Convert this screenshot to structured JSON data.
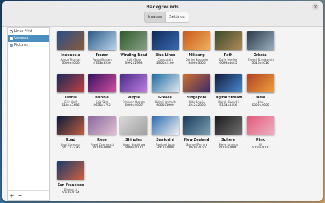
{
  "window": {
    "title": "Backgrounds",
    "close_icon": "×"
  },
  "tabs": [
    {
      "label": "Images",
      "active": true
    },
    {
      "label": "Settings",
      "active": false
    }
  ],
  "sidebar": {
    "items": [
      {
        "label": "Linux Mint",
        "icon": "disc-icon",
        "selected": false
      },
      {
        "label": "Vanessa",
        "icon": "folder-icon",
        "selected": true
      },
      {
        "label": "Pictures",
        "icon": "folder-icon",
        "selected": false
      }
    ],
    "add_label": "+",
    "remove_label": "−"
  },
  "wallpapers": [
    {
      "name": "Indonesia",
      "author": "Aaron Thomas",
      "size": "6000x4000",
      "color": "#2a4f88",
      "color2": "#8b5a3a"
    },
    {
      "name": "Frozen",
      "author": "Aaron Burden",
      "size": "4733x3550",
      "color": "#2e5c8a",
      "color2": "#b9d3ea"
    },
    {
      "name": "Winding Road",
      "author": "Calin Stan",
      "size": "3992x2992",
      "color": "#2f5a2a",
      "color2": "#8aa28a"
    },
    {
      "name": "Blue Lines",
      "author": "Constantin",
      "size": "2800x2100",
      "color": "#0f2a5a",
      "color2": "#3a6ab0"
    },
    {
      "name": "Miksang",
      "author": "Denise Bossarte",
      "size": "5400x3600",
      "color": "#c85a1a",
      "color2": "#f0b060"
    },
    {
      "name": "Path",
      "author": "Dave Hoefler",
      "size": "6698x4445",
      "color": "#3a4a2a",
      "color2": "#b08a5a"
    },
    {
      "name": "Orketal",
      "author": "Evgeni Tcherkasski",
      "size": "6016x4016",
      "color": "#2a3a4a",
      "color2": "#9ab0c0"
    },
    {
      "name": "Tennis",
      "author": "Erik Wolf",
      "size": "5184x3456",
      "color": "#1a2a5a",
      "color2": "#c04040"
    },
    {
      "name": "Bubble",
      "author": "Erik Skof",
      "size": "4635x1752",
      "color": "#3a1060",
      "color2": "#d050a0"
    },
    {
      "name": "Purple",
      "author": "Fabonan Design",
      "size": "6000x4000",
      "color": "#4a2a8a",
      "color2": "#c080e0"
    },
    {
      "name": "Greece",
      "author": "Hello Lightbulb",
      "size": "6000x4000",
      "color": "#1a6aa0",
      "color2": "#e0e8f0"
    },
    {
      "name": "Singapore",
      "author": "Mike Enerio",
      "size": "4242x2828",
      "color": "#d07030",
      "color2": "#3a2a6a"
    },
    {
      "name": "Digital Stream",
      "author": "Marek Piwnicki",
      "size": "5184x3456",
      "color": "#101a3a",
      "color2": "#4a8ad0"
    },
    {
      "name": "India",
      "author": "Navi",
      "size": "6000x4000",
      "color": "#b04020",
      "color2": "#f0a040"
    },
    {
      "name": "Road",
      "author": "Paul Carmona",
      "size": "5472x3236",
      "color": "#0a1a3a",
      "color2": "#c06040"
    },
    {
      "name": "Rose",
      "author": "Pawel Czerwinski",
      "size": "6000x4000",
      "color": "#8a6aa0",
      "color2": "#e0c0d0"
    },
    {
      "name": "Shingles",
      "author": "Roger Bradshaw",
      "size": "6000x4000",
      "color": "#d8d8d8",
      "color2": "#a0a0a0"
    },
    {
      "name": "Santorini",
      "author": "Raphael Louis",
      "size": "2667x4000",
      "color": "#2a6ab0",
      "color2": "#f0f0f0"
    },
    {
      "name": "New Zealand",
      "author": "Samuel Ferrara",
      "size": "3840x2160",
      "color": "#1a3a5a",
      "color2": "#7aa0b0"
    },
    {
      "name": "Sphere",
      "author": "Steve Johnson",
      "size": "6000x4000",
      "color": "#1a1a1a",
      "color2": "#707070"
    },
    {
      "name": "Pink",
      "author": "W",
      "size": "6000x4000",
      "color": "#e05a7a",
      "color2": "#f0b0c0"
    },
    {
      "name": "San Francisco",
      "author": "Zeoing Li",
      "size": "6048x4024",
      "color": "#1a3a6a",
      "color2": "#d06040"
    }
  ]
}
